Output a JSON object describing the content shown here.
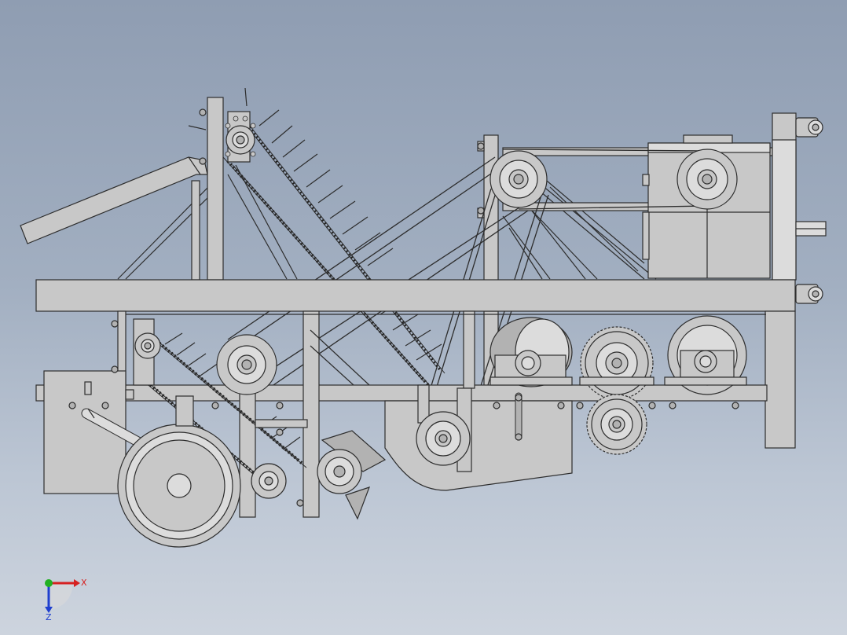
{
  "view": {
    "background_top": "#8f9db2",
    "background_bottom": "#cdd4de",
    "part_fill": "#c8c8c8",
    "edge_color": "#2d2d2d"
  },
  "triad": {
    "x_label": "X",
    "z_label": "Z",
    "x_color": "#d62020",
    "y_color": "#22b022",
    "z_color": "#1f3fcf"
  }
}
